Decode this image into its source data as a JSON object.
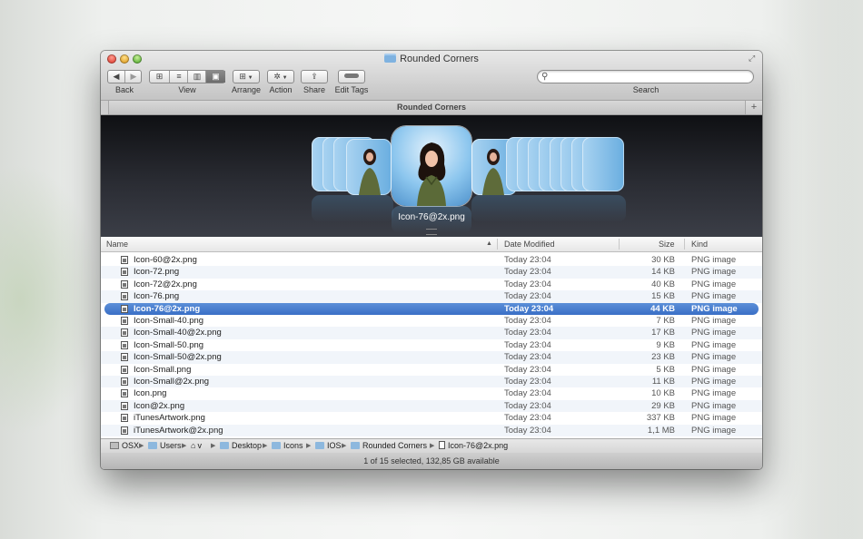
{
  "window": {
    "title": "Rounded Corners"
  },
  "toolbar": {
    "back_label": "Back",
    "view_label": "View",
    "arrange_label": "Arrange",
    "action_label": "Action",
    "share_label": "Share",
    "edit_tags_label": "Edit Tags",
    "search_label": "Search",
    "search_value": "",
    "view_selected": "cover-flow"
  },
  "tab": {
    "title": "Rounded Corners"
  },
  "coverflow": {
    "caption": "Icon-76@2x.png"
  },
  "list": {
    "columns": {
      "name": "Name",
      "date": "Date Modified",
      "size": "Size",
      "kind": "Kind"
    },
    "sort_column": "Name",
    "rows": [
      {
        "name": "Icon-60@2x.png",
        "date": "Today 23:04",
        "size": "30 KB",
        "kind": "PNG image"
      },
      {
        "name": "Icon-72.png",
        "date": "Today 23:04",
        "size": "14 KB",
        "kind": "PNG image"
      },
      {
        "name": "Icon-72@2x.png",
        "date": "Today 23:04",
        "size": "40 KB",
        "kind": "PNG image"
      },
      {
        "name": "Icon-76.png",
        "date": "Today 23:04",
        "size": "15 KB",
        "kind": "PNG image"
      },
      {
        "name": "Icon-76@2x.png",
        "date": "Today 23:04",
        "size": "44 KB",
        "kind": "PNG image",
        "selected": true
      },
      {
        "name": "Icon-Small-40.png",
        "date": "Today 23:04",
        "size": "7 KB",
        "kind": "PNG image"
      },
      {
        "name": "Icon-Small-40@2x.png",
        "date": "Today 23:04",
        "size": "17 KB",
        "kind": "PNG image"
      },
      {
        "name": "Icon-Small-50.png",
        "date": "Today 23:04",
        "size": "9 KB",
        "kind": "PNG image"
      },
      {
        "name": "Icon-Small-50@2x.png",
        "date": "Today 23:04",
        "size": "23 KB",
        "kind": "PNG image"
      },
      {
        "name": "Icon-Small.png",
        "date": "Today 23:04",
        "size": "5 KB",
        "kind": "PNG image"
      },
      {
        "name": "Icon-Small@2x.png",
        "date": "Today 23:04",
        "size": "11 KB",
        "kind": "PNG image"
      },
      {
        "name": "Icon.png",
        "date": "Today 23:04",
        "size": "10 KB",
        "kind": "PNG image"
      },
      {
        "name": "Icon@2x.png",
        "date": "Today 23:04",
        "size": "29 KB",
        "kind": "PNG image"
      },
      {
        "name": "iTunesArtwork.png",
        "date": "Today 23:04",
        "size": "337 KB",
        "kind": "PNG image"
      },
      {
        "name": "iTunesArtwork@2x.png",
        "date": "Today 23:04",
        "size": "1,1 MB",
        "kind": "PNG image"
      }
    ]
  },
  "pathbar": {
    "items": [
      "OSX",
      "Users",
      "v",
      "Desktop",
      "Icons",
      "IOS",
      "Rounded Corners",
      "Icon-76@2x.png"
    ]
  },
  "status": {
    "text": "1 of 15 selected, 132,85 GB available"
  },
  "colors": {
    "selection": "#3a6fc6",
    "folder": "#8db8de"
  }
}
